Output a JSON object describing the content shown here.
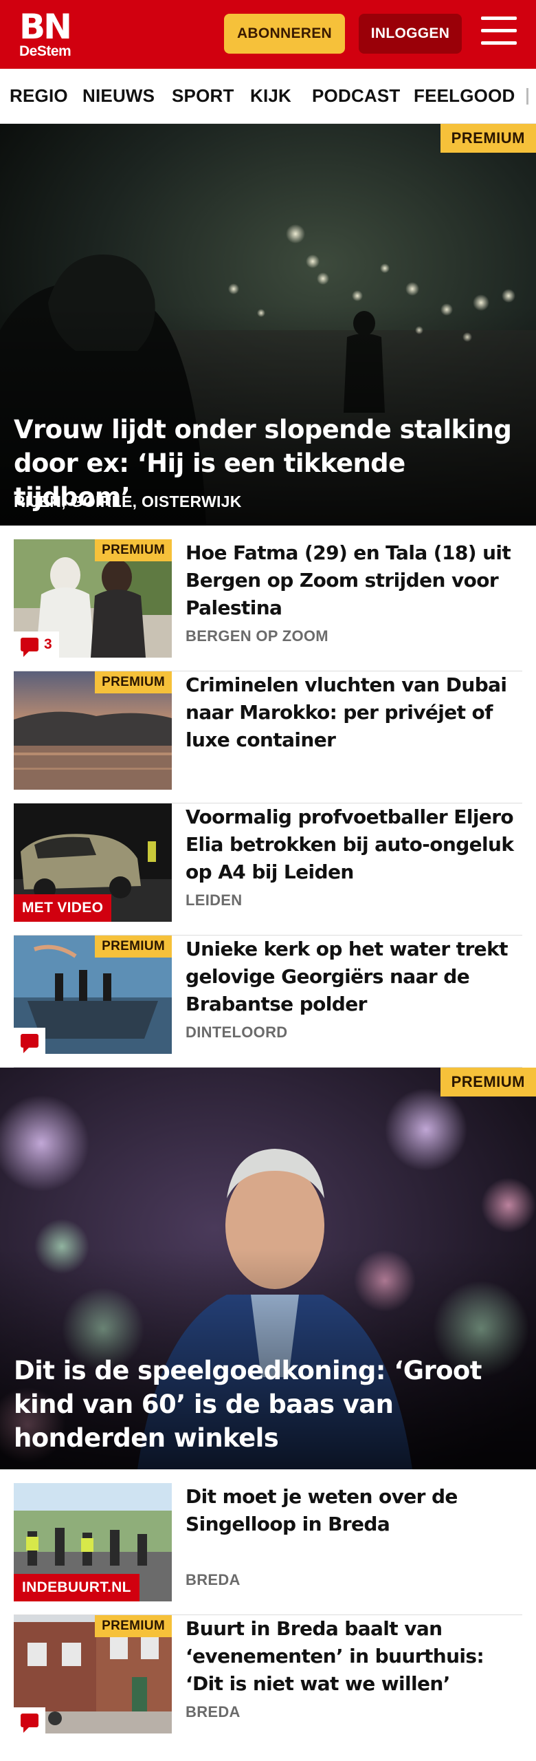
{
  "header": {
    "logo_main": "BN",
    "logo_sub": "DeStem",
    "subscribe_label": "ABONNEREN",
    "login_label": "INLOGGEN",
    "brand_color": "#d1000f",
    "accent_color": "#f6c13a"
  },
  "nav": {
    "items": [
      "REGIO",
      "NIEUWS",
      "SPORT",
      "KIJK",
      "PODCAST",
      "FEELGOOD"
    ]
  },
  "hero1": {
    "badge": "PREMIUM",
    "title": "Vrouw lijdt onder slopende stalking door ex: ‘Hij is een tikkende tijdbom’",
    "location": "RIJEN, GOIRLE, OISTERWIJK"
  },
  "articles": [
    {
      "badge": "PREMIUM",
      "title": "Hoe Fatma (29) en Tala (18) uit Bergen op Zoom strijden voor Palestina",
      "location": "BERGEN OP ZOOM",
      "comments": "3"
    },
    {
      "badge": "PREMIUM",
      "title": "Criminelen vluchten van Dubai naar Marokko: per privéjet of luxe container",
      "location": ""
    },
    {
      "label": "MET VIDEO",
      "title": "Voormalig profvoetballer Eljero Elia betrokken bij auto-ongeluk op A4 bij Leiden",
      "location": "LEIDEN"
    },
    {
      "badge": "PREMIUM",
      "title": "Unieke kerk op het water trekt gelovige Georgiërs naar de Brabantse polder",
      "location": "DINTELOORD",
      "comments": ""
    }
  ],
  "hero2": {
    "badge": "PREMIUM",
    "title": "Dit is de speelgoedkoning: ‘Groot kind van 60’ is de baas van honderden winkels"
  },
  "articles2": [
    {
      "label": "INDEBUURT.NL",
      "title": "Dit moet je weten over de Singelloop in Breda",
      "location": "BREDA"
    },
    {
      "badge": "PREMIUM",
      "title": "Buurt in Breda baalt van ‘evenementen’ in buurthuis: ‘Dit is niet wat we willen’",
      "location": "BREDA",
      "comments": ""
    }
  ]
}
